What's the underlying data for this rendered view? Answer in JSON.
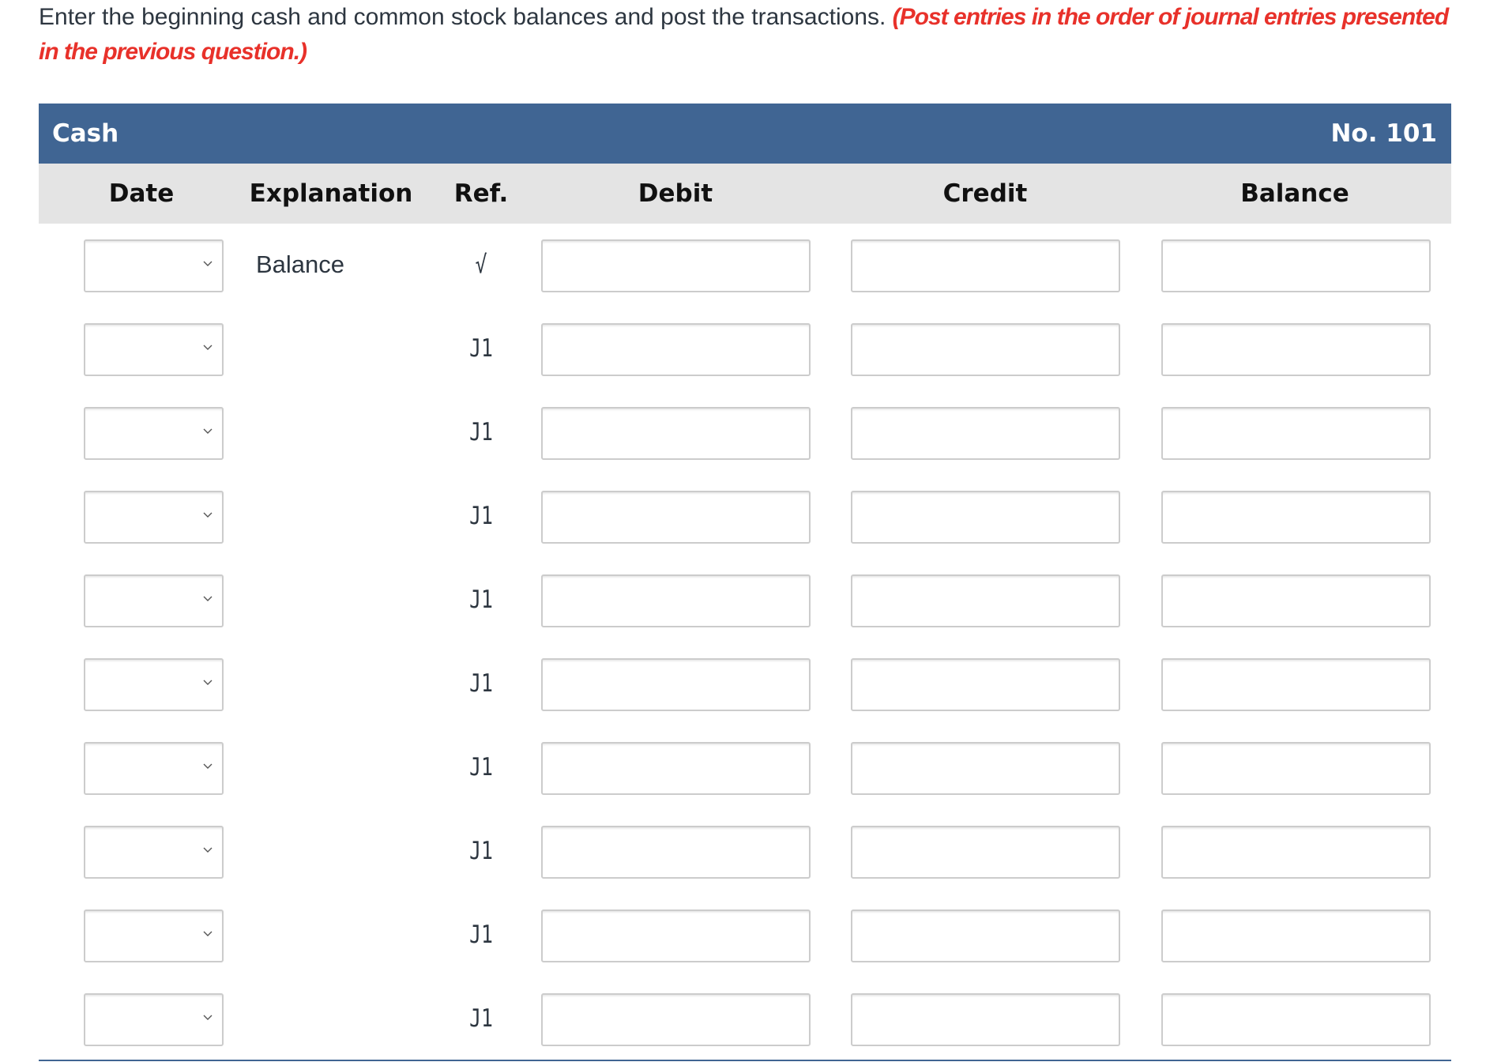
{
  "instructions": {
    "text": "Enter the beginning cash and common stock balances and post the transactions.",
    "emphasis": "(Post entries in the order of journal entries presented in the previous question.)"
  },
  "account": {
    "name": "Cash",
    "number": "No. 101"
  },
  "columns": {
    "date": "Date",
    "explanation": "Explanation",
    "ref": "Ref.",
    "debit": "Debit",
    "credit": "Credit",
    "balance": "Balance"
  },
  "rows": [
    {
      "date": "",
      "explanation": "Balance",
      "ref": "√",
      "debit": "",
      "credit": "",
      "balance": ""
    },
    {
      "date": "",
      "explanation": "",
      "ref": "J1",
      "debit": "",
      "credit": "",
      "balance": ""
    },
    {
      "date": "",
      "explanation": "",
      "ref": "J1",
      "debit": "",
      "credit": "",
      "balance": ""
    },
    {
      "date": "",
      "explanation": "",
      "ref": "J1",
      "debit": "",
      "credit": "",
      "balance": ""
    },
    {
      "date": "",
      "explanation": "",
      "ref": "J1",
      "debit": "",
      "credit": "",
      "balance": ""
    },
    {
      "date": "",
      "explanation": "",
      "ref": "J1",
      "debit": "",
      "credit": "",
      "balance": ""
    },
    {
      "date": "",
      "explanation": "",
      "ref": "J1",
      "debit": "",
      "credit": "",
      "balance": ""
    },
    {
      "date": "",
      "explanation": "",
      "ref": "J1",
      "debit": "",
      "credit": "",
      "balance": ""
    },
    {
      "date": "",
      "explanation": "",
      "ref": "J1",
      "debit": "",
      "credit": "",
      "balance": ""
    },
    {
      "date": "",
      "explanation": "",
      "ref": "J1",
      "debit": "",
      "credit": "",
      "balance": ""
    }
  ],
  "icons": {
    "date_dropdown": "chevron-down-icon"
  },
  "colors": {
    "header_bg": "#406593",
    "column_header_bg": "#e4e4e4",
    "emphasis_text": "#e8312a",
    "body_text": "#2d3640"
  }
}
